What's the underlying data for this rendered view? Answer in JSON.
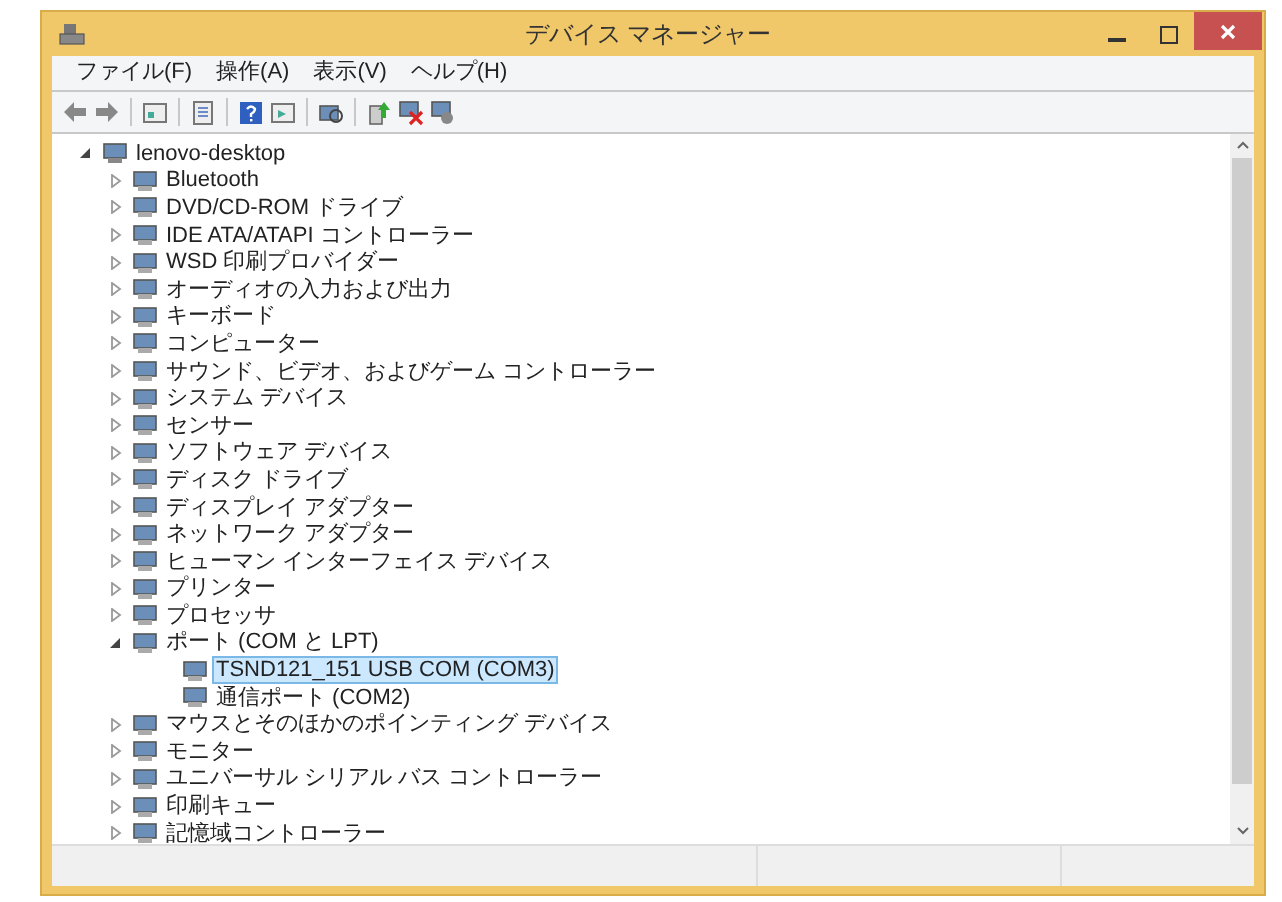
{
  "window": {
    "title": "デバイス マネージャー"
  },
  "menu": [
    "ファイル(F)",
    "操作(A)",
    "表示(V)",
    "ヘルプ(H)"
  ],
  "tree": {
    "label": "lenovo-desktop",
    "expanded": true,
    "selected": false,
    "children": [
      {
        "label": "Bluetooth",
        "expanded": false,
        "selected": false
      },
      {
        "label": "DVD/CD-ROM ドライブ",
        "expanded": false,
        "selected": false
      },
      {
        "label": "IDE ATA/ATAPI コントローラー",
        "expanded": false,
        "selected": false
      },
      {
        "label": "WSD 印刷プロバイダー",
        "expanded": false,
        "selected": false
      },
      {
        "label": "オーディオの入力および出力",
        "expanded": false,
        "selected": false
      },
      {
        "label": "キーボード",
        "expanded": false,
        "selected": false
      },
      {
        "label": "コンピューター",
        "expanded": false,
        "selected": false
      },
      {
        "label": "サウンド、ビデオ、およびゲーム コントローラー",
        "expanded": false,
        "selected": false
      },
      {
        "label": "システム デバイス",
        "expanded": false,
        "selected": false
      },
      {
        "label": "センサー",
        "expanded": false,
        "selected": false
      },
      {
        "label": "ソフトウェア デバイス",
        "expanded": false,
        "selected": false
      },
      {
        "label": "ディスク ドライブ",
        "expanded": false,
        "selected": false
      },
      {
        "label": "ディスプレイ アダプター",
        "expanded": false,
        "selected": false
      },
      {
        "label": "ネットワーク アダプター",
        "expanded": false,
        "selected": false
      },
      {
        "label": "ヒューマン インターフェイス デバイス",
        "expanded": false,
        "selected": false
      },
      {
        "label": "プリンター",
        "expanded": false,
        "selected": false
      },
      {
        "label": "プロセッサ",
        "expanded": false,
        "selected": false
      },
      {
        "label": "ポート (COM と LPT)",
        "expanded": true,
        "selected": false,
        "children": [
          {
            "label": "TSND121_151 USB COM (COM3)",
            "selected": true
          },
          {
            "label": "通信ポート (COM2)",
            "selected": false
          }
        ]
      },
      {
        "label": "マウスとそのほかのポインティング デバイス",
        "expanded": false,
        "selected": false
      },
      {
        "label": "モニター",
        "expanded": false,
        "selected": false
      },
      {
        "label": "ユニバーサル シリアル バス コントローラー",
        "expanded": false,
        "selected": false
      },
      {
        "label": "印刷キュー",
        "expanded": false,
        "selected": false
      },
      {
        "label": "記憶域コントローラー",
        "expanded": false,
        "selected": false
      }
    ]
  }
}
